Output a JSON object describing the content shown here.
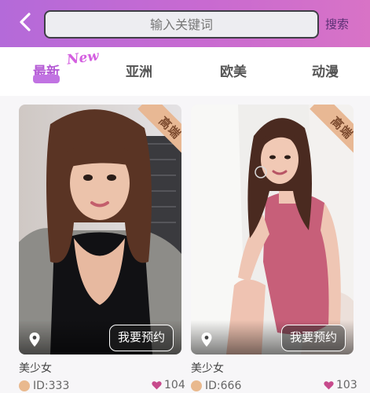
{
  "header": {
    "search_placeholder": "输入关键词",
    "search_button": "搜索"
  },
  "tabs": [
    {
      "label": "最新",
      "active": true,
      "badge": "New"
    },
    {
      "label": "亚洲",
      "active": false
    },
    {
      "label": "欧美",
      "active": false
    },
    {
      "label": "动漫",
      "active": false
    }
  ],
  "cards": [
    {
      "ribbon": "高端",
      "book_label": "我要预约",
      "name": "美少女",
      "id": "ID:333",
      "likes": "104"
    },
    {
      "ribbon": "高端",
      "book_label": "我要预约",
      "name": "美少女",
      "id": "ID:666",
      "likes": "103"
    }
  ],
  "colors": {
    "header_start": "#b46ad9",
    "header_end": "#d873c6",
    "active_tab": "#b45ad5",
    "ribbon": "#e8b894",
    "heart": "#c74a8c"
  }
}
